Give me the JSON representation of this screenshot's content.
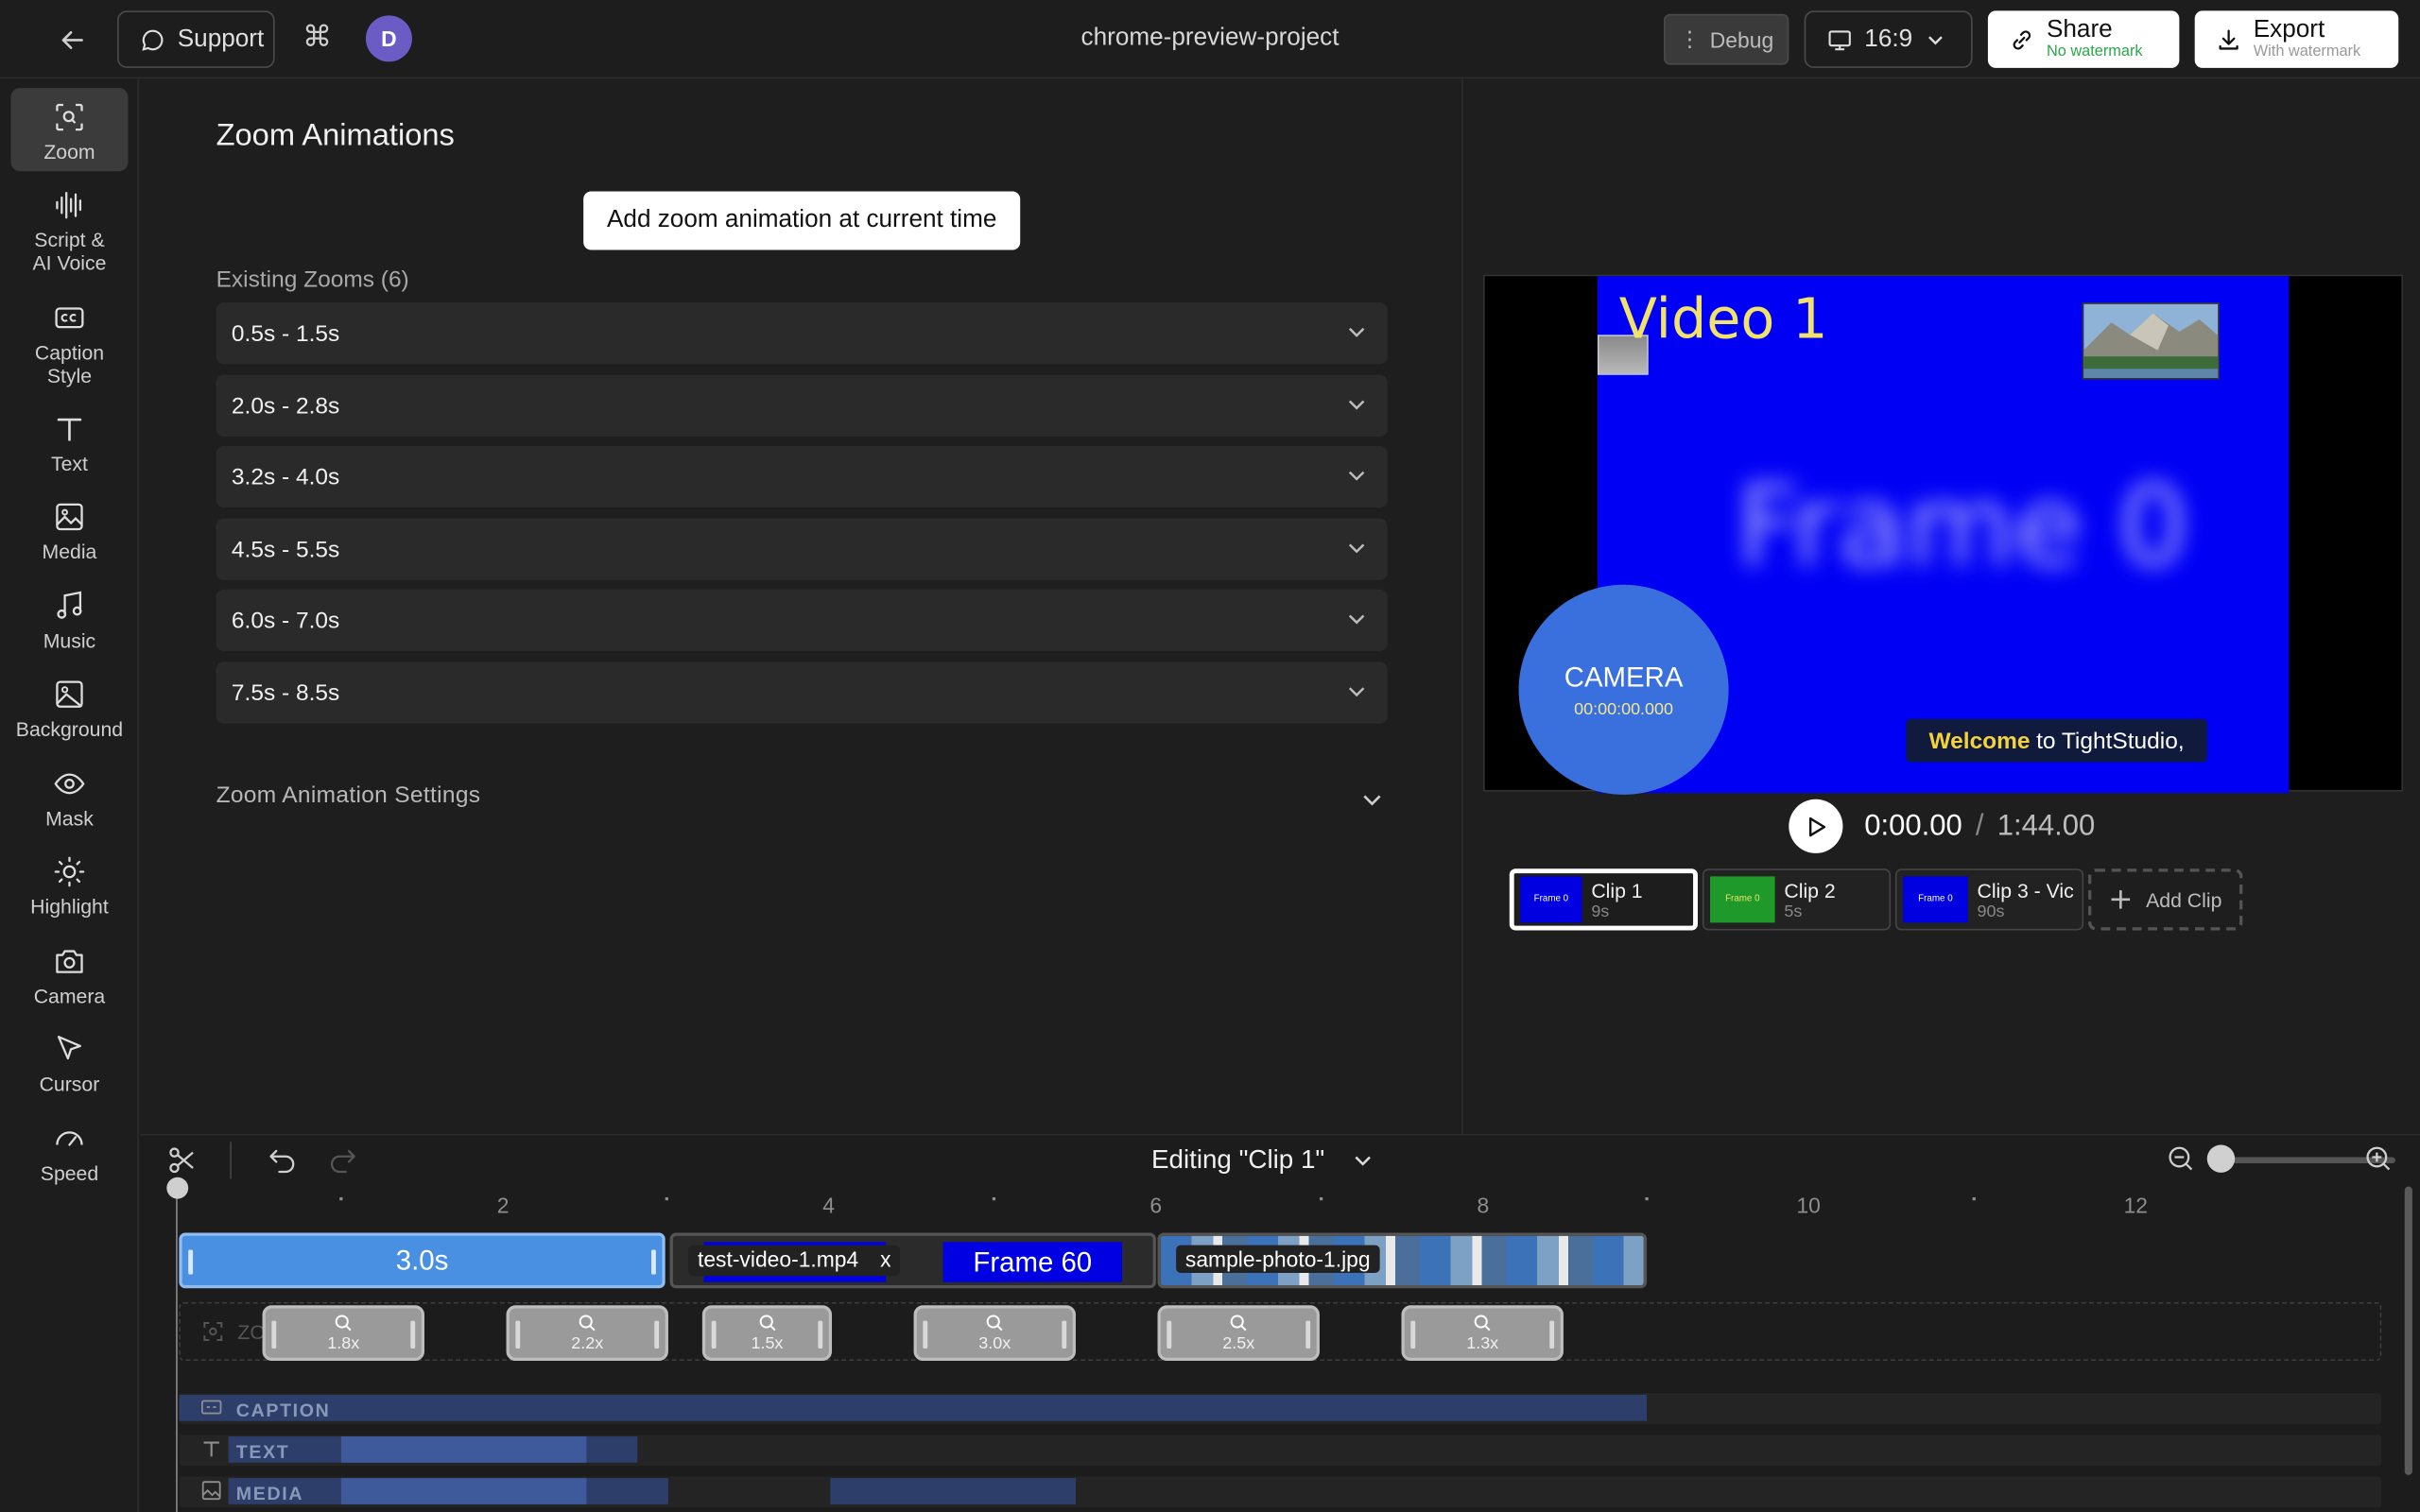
{
  "topbar": {
    "support_label": "Support",
    "avatar_initial": "D",
    "project_title": "chrome-preview-project",
    "debug_label": "Debug",
    "aspect_label": "16:9",
    "share_label": "Share",
    "share_sub": "No watermark",
    "export_label": "Export",
    "export_sub": "With watermark"
  },
  "sidebar": {
    "items": [
      {
        "label": "Zoom",
        "icon": "zoom-scan-icon",
        "active": true
      },
      {
        "label": "Script &\nAI Voice",
        "icon": "waveform-icon"
      },
      {
        "label": "Caption\nStyle",
        "icon": "cc-icon"
      },
      {
        "label": "Text",
        "icon": "text-icon"
      },
      {
        "label": "Media",
        "icon": "media-icon"
      },
      {
        "label": "Music",
        "icon": "music-icon"
      },
      {
        "label": "Background",
        "icon": "image-icon"
      },
      {
        "label": "Mask",
        "icon": "eye-icon"
      },
      {
        "label": "Highlight",
        "icon": "sun-icon"
      },
      {
        "label": "Camera",
        "icon": "camera-icon"
      },
      {
        "label": "Cursor",
        "icon": "cursor-icon"
      },
      {
        "label": "Speed",
        "icon": "speedometer-icon"
      }
    ]
  },
  "panel": {
    "title": "Zoom Animations",
    "add_button": "Add zoom animation at current time",
    "existing_label": "Existing Zooms (6)",
    "zooms": [
      "0.5s - 1.5s",
      "2.0s - 2.8s",
      "3.2s - 4.0s",
      "4.5s - 5.5s",
      "6.0s - 7.0s",
      "7.5s - 8.5s"
    ],
    "settings_label": "Zoom Animation Settings"
  },
  "preview": {
    "video_title": "Video 1",
    "frame_text": "Frame 0",
    "camera_label": "CAMERA",
    "camera_time": "00:00:00.000",
    "caption_highlight": "Welcome",
    "caption_rest": "to TightStudio,",
    "time_current": "0:00.00",
    "time_sep": "/",
    "time_total": "1:44.00",
    "clips": [
      {
        "name": "Clip 1",
        "duration": "9s",
        "thumb_color": "#0000e0",
        "thumb_text": "Frame 0",
        "active": true
      },
      {
        "name": "Clip 2",
        "duration": "5s",
        "thumb_color": "#1f9a2a",
        "thumb_text": "Frame 0"
      },
      {
        "name": "Clip 3 - Vic",
        "duration": "90s",
        "thumb_color": "#0000e0",
        "thumb_text": "Frame 0"
      }
    ],
    "add_clip_label": "Add Clip"
  },
  "timeline": {
    "editing_label": "Editing \"Clip 1\"",
    "ruler": [
      "2",
      "4",
      "6",
      "8",
      "10",
      "12"
    ],
    "clip_a_label": "3.0s",
    "clip_b_label": "test-video-1.mp4",
    "clip_b_close": "x",
    "clip_b_frame": "Frame 60",
    "clip_c_label": "sample-photo-1.jpg",
    "zoom_track_label": "ZO",
    "zoom_chips": [
      "1.8x",
      "2.2x",
      "1.5x",
      "3.0x",
      "2.5x",
      "1.3x"
    ],
    "caption_track": "CAPTION",
    "text_track": "TEXT",
    "media_track": "MEDIA"
  }
}
